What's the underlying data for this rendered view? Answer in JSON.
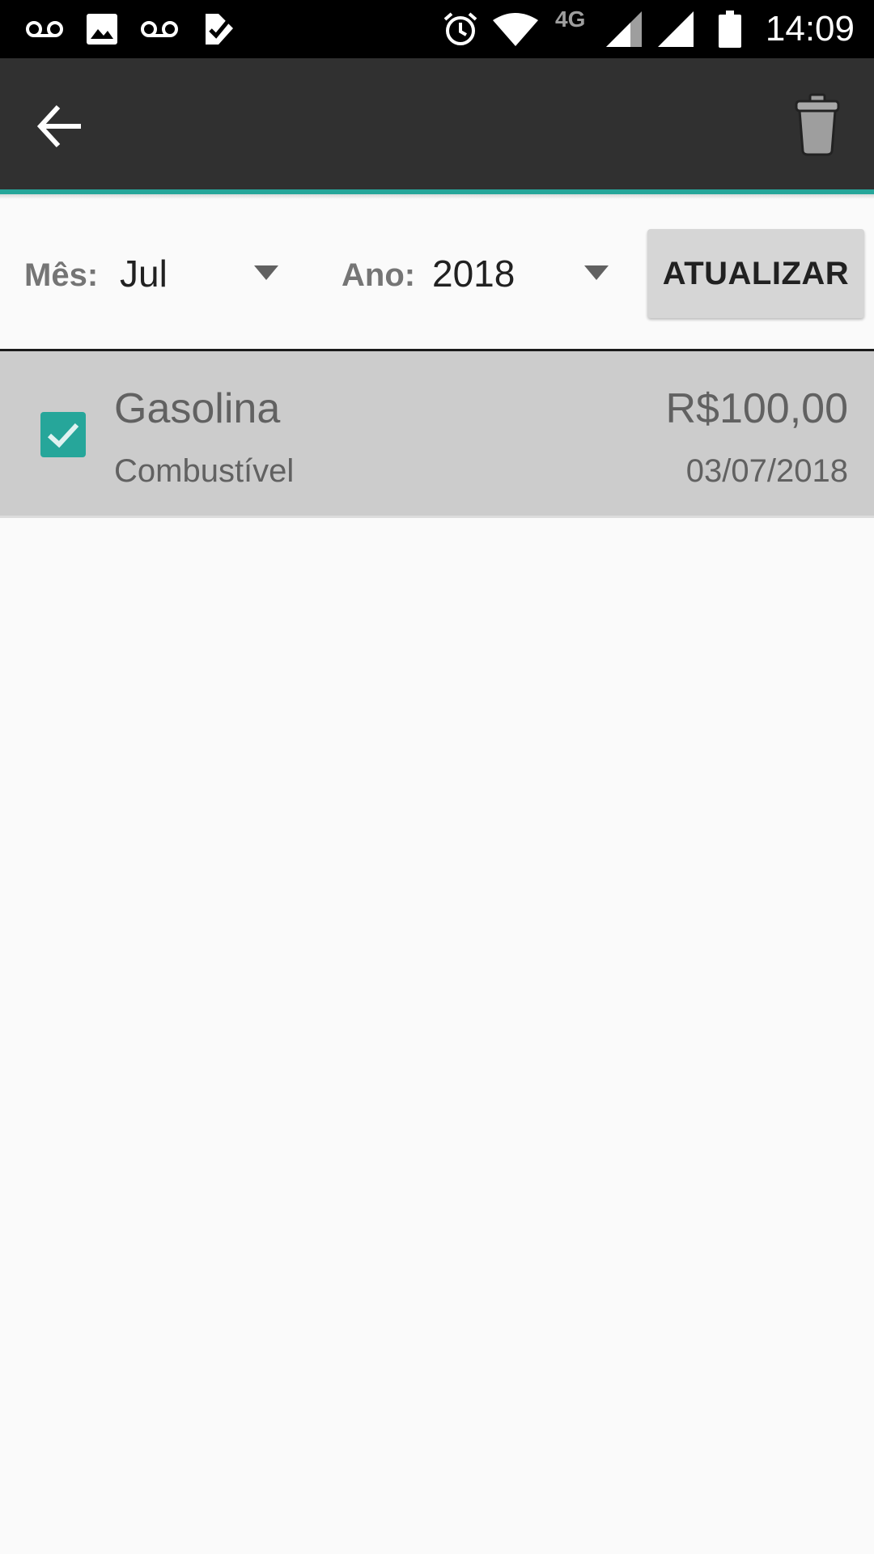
{
  "status_bar": {
    "time": "14:09",
    "network": "4G",
    "icons": [
      "voicemail-icon",
      "image-icon",
      "voicemail-icon",
      "task-check-icon",
      "alarm-icon",
      "wifi-icon",
      "signal-icon",
      "signal-icon",
      "battery-icon"
    ]
  },
  "toolbar": {
    "back_icon": "arrow-left-icon",
    "trash_icon": "trash-icon",
    "accent_color": "#26a69a",
    "background_color": "#303030"
  },
  "filters": {
    "month_label": "Mês:",
    "month_value": "Jul",
    "year_label": "Ano:",
    "year_value": "2018",
    "update_button": "ATUALIZAR"
  },
  "expenses": [
    {
      "checked": true,
      "name": "Gasolina",
      "category": "Combustível",
      "value": "R$100,00",
      "date": "03/07/2018"
    }
  ]
}
